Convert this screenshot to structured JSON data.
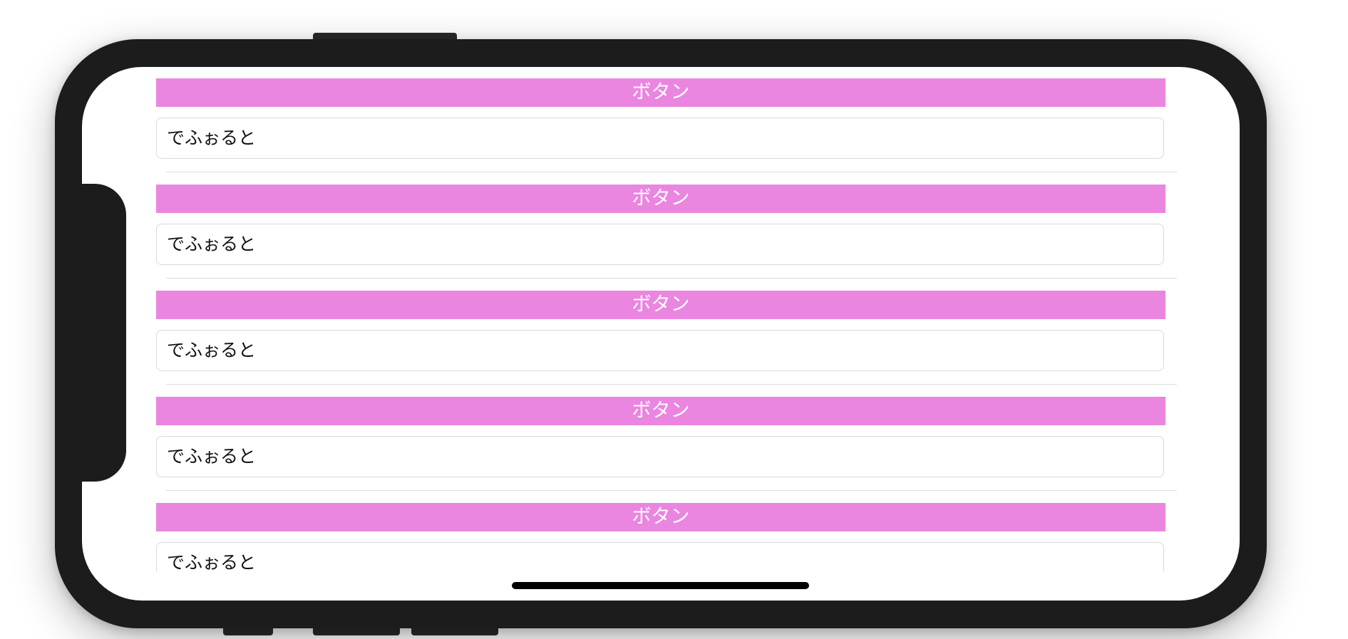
{
  "rows": [
    {
      "button_label": "ボタン",
      "field_value": "でふぉると"
    },
    {
      "button_label": "ボタン",
      "field_value": "でふぉると"
    },
    {
      "button_label": "ボタン",
      "field_value": "でふぉると"
    },
    {
      "button_label": "ボタン",
      "field_value": "でふぉると"
    },
    {
      "button_label": "ボタン",
      "field_value": "でふぉると"
    }
  ],
  "colors": {
    "button_background": "#ea86e0",
    "button_text": "#ffffff",
    "device_frame": "#1c1c1c"
  }
}
